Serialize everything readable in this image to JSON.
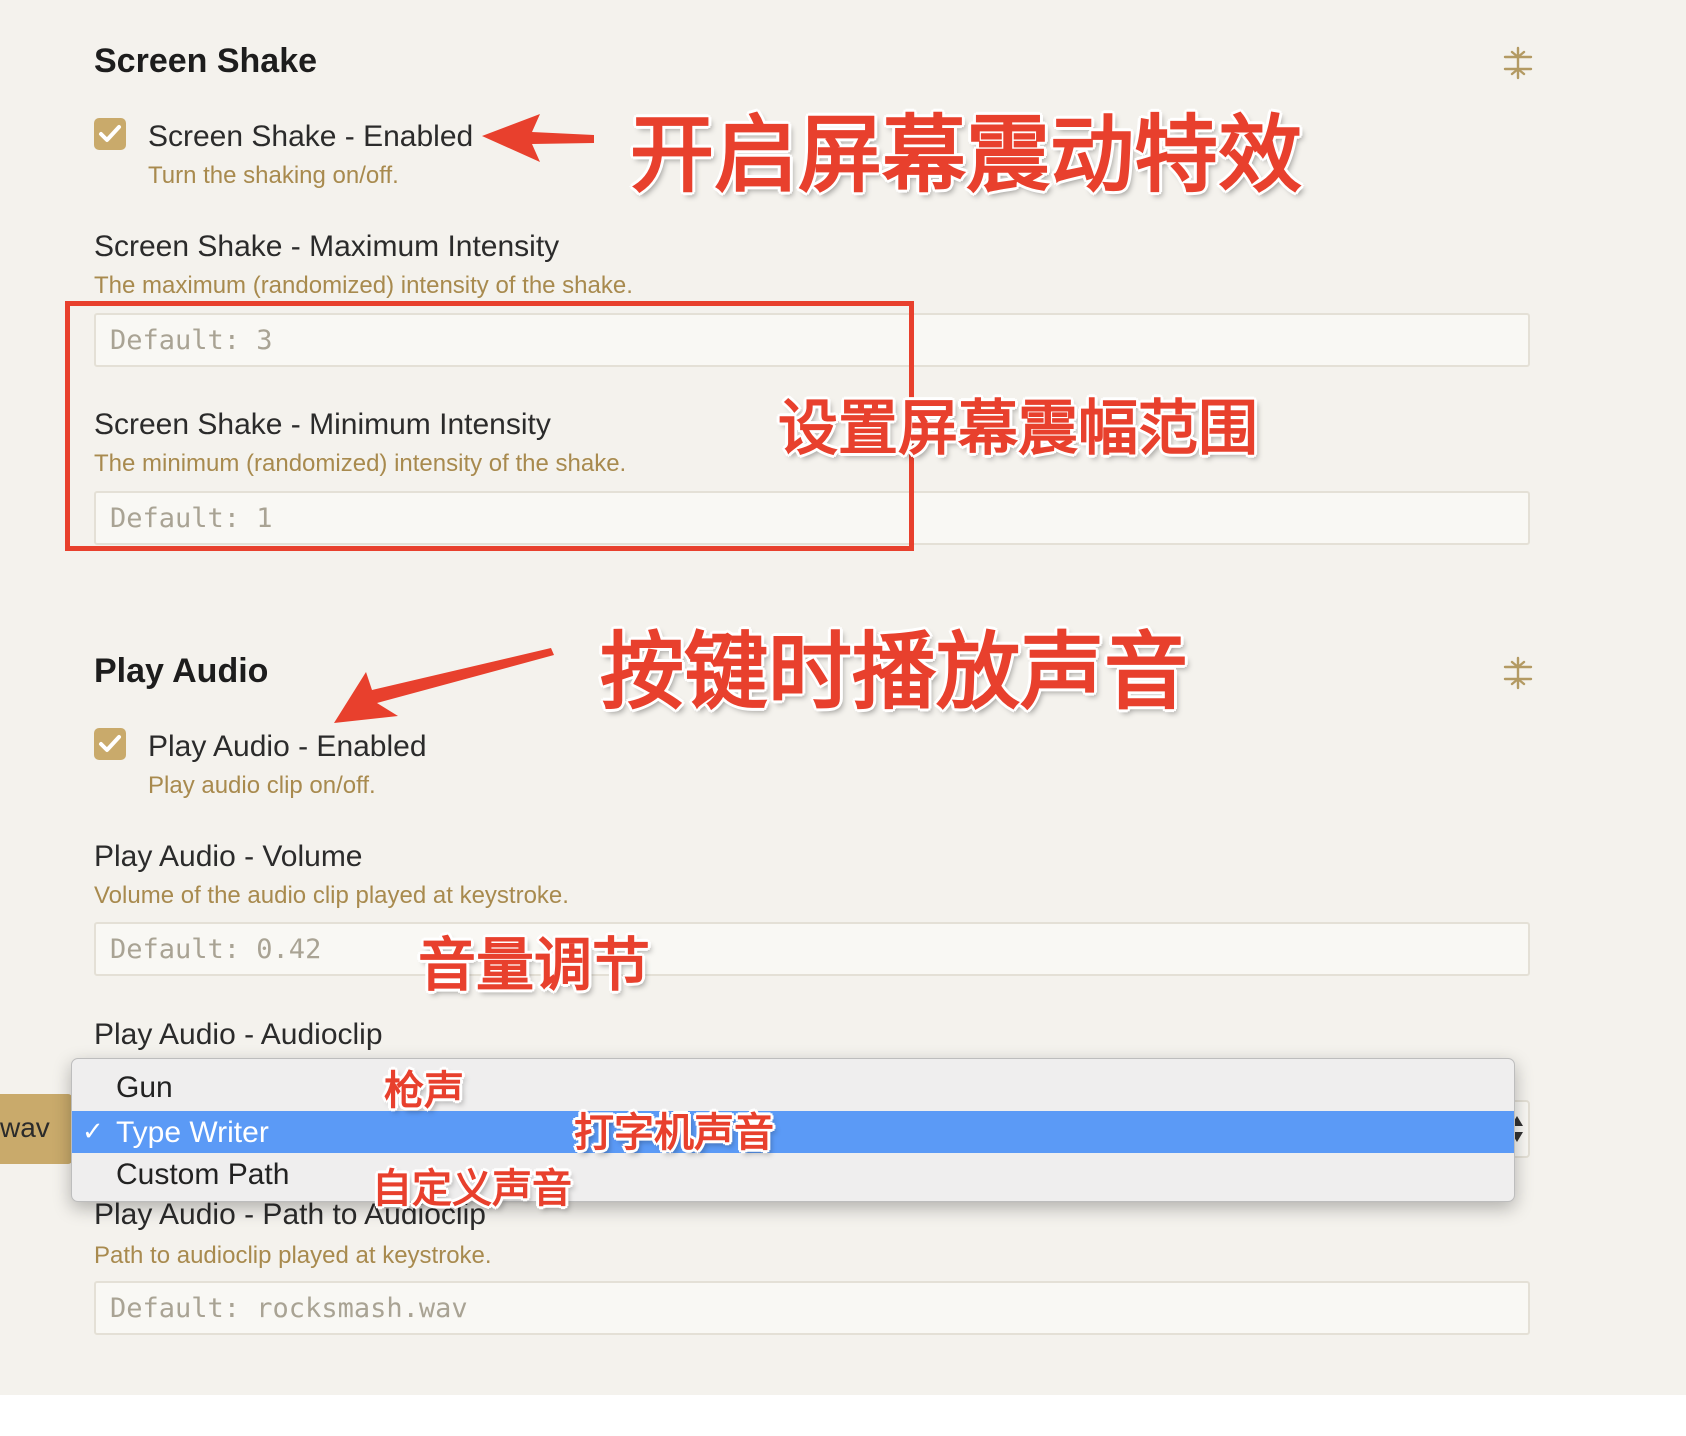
{
  "colors": {
    "panel_background": "#f4f2ed",
    "accent_gold": "#c9aa6b",
    "description_text": "#a88a4e",
    "dropdown_selected": "#5b9af6",
    "annotation_red": "#e8402d"
  },
  "screen_shake": {
    "title": "Screen Shake",
    "settings_icon": "gear-cog-icon",
    "enabled": {
      "label": "Screen Shake - Enabled",
      "description": "Turn the shaking on/off.",
      "checked": true
    },
    "max_intensity": {
      "label": "Screen Shake - Maximum Intensity",
      "description": "The maximum (randomized) intensity of the shake.",
      "placeholder": "Default: 3"
    },
    "min_intensity": {
      "label": "Screen Shake - Minimum Intensity",
      "description": "The minimum (randomized) intensity of the shake.",
      "placeholder": "Default: 1"
    }
  },
  "play_audio": {
    "title": "Play Audio",
    "settings_icon": "gear-cog-icon",
    "enabled": {
      "label": "Play Audio - Enabled",
      "description": "Play audio clip on/off.",
      "checked": true
    },
    "volume": {
      "label": "Play Audio - Volume",
      "description": "Volume of the audio clip played at keystroke.",
      "placeholder": "Default: 0.42"
    },
    "audioclip": {
      "label": "Play Audio - Audioclip",
      "selected": "Type Writer",
      "options": [
        "Gun",
        "Type Writer",
        "Custom Path"
      ],
      "side_tag": "wav"
    },
    "path": {
      "label": "Play Audio - Path to Audioclip",
      "description": "Path to audioclip played at keystroke.",
      "placeholder": "Default: rocksmash.wav"
    }
  },
  "annotations": {
    "enable_shake": "开启屏幕震动特效",
    "shake_range": "设置屏幕震幅范围",
    "play_on_key": "按键时播放声音",
    "volume_adjust": "音量调节",
    "gun": "枪声",
    "type_writer": "打字机声音",
    "custom": "自定义声音"
  }
}
